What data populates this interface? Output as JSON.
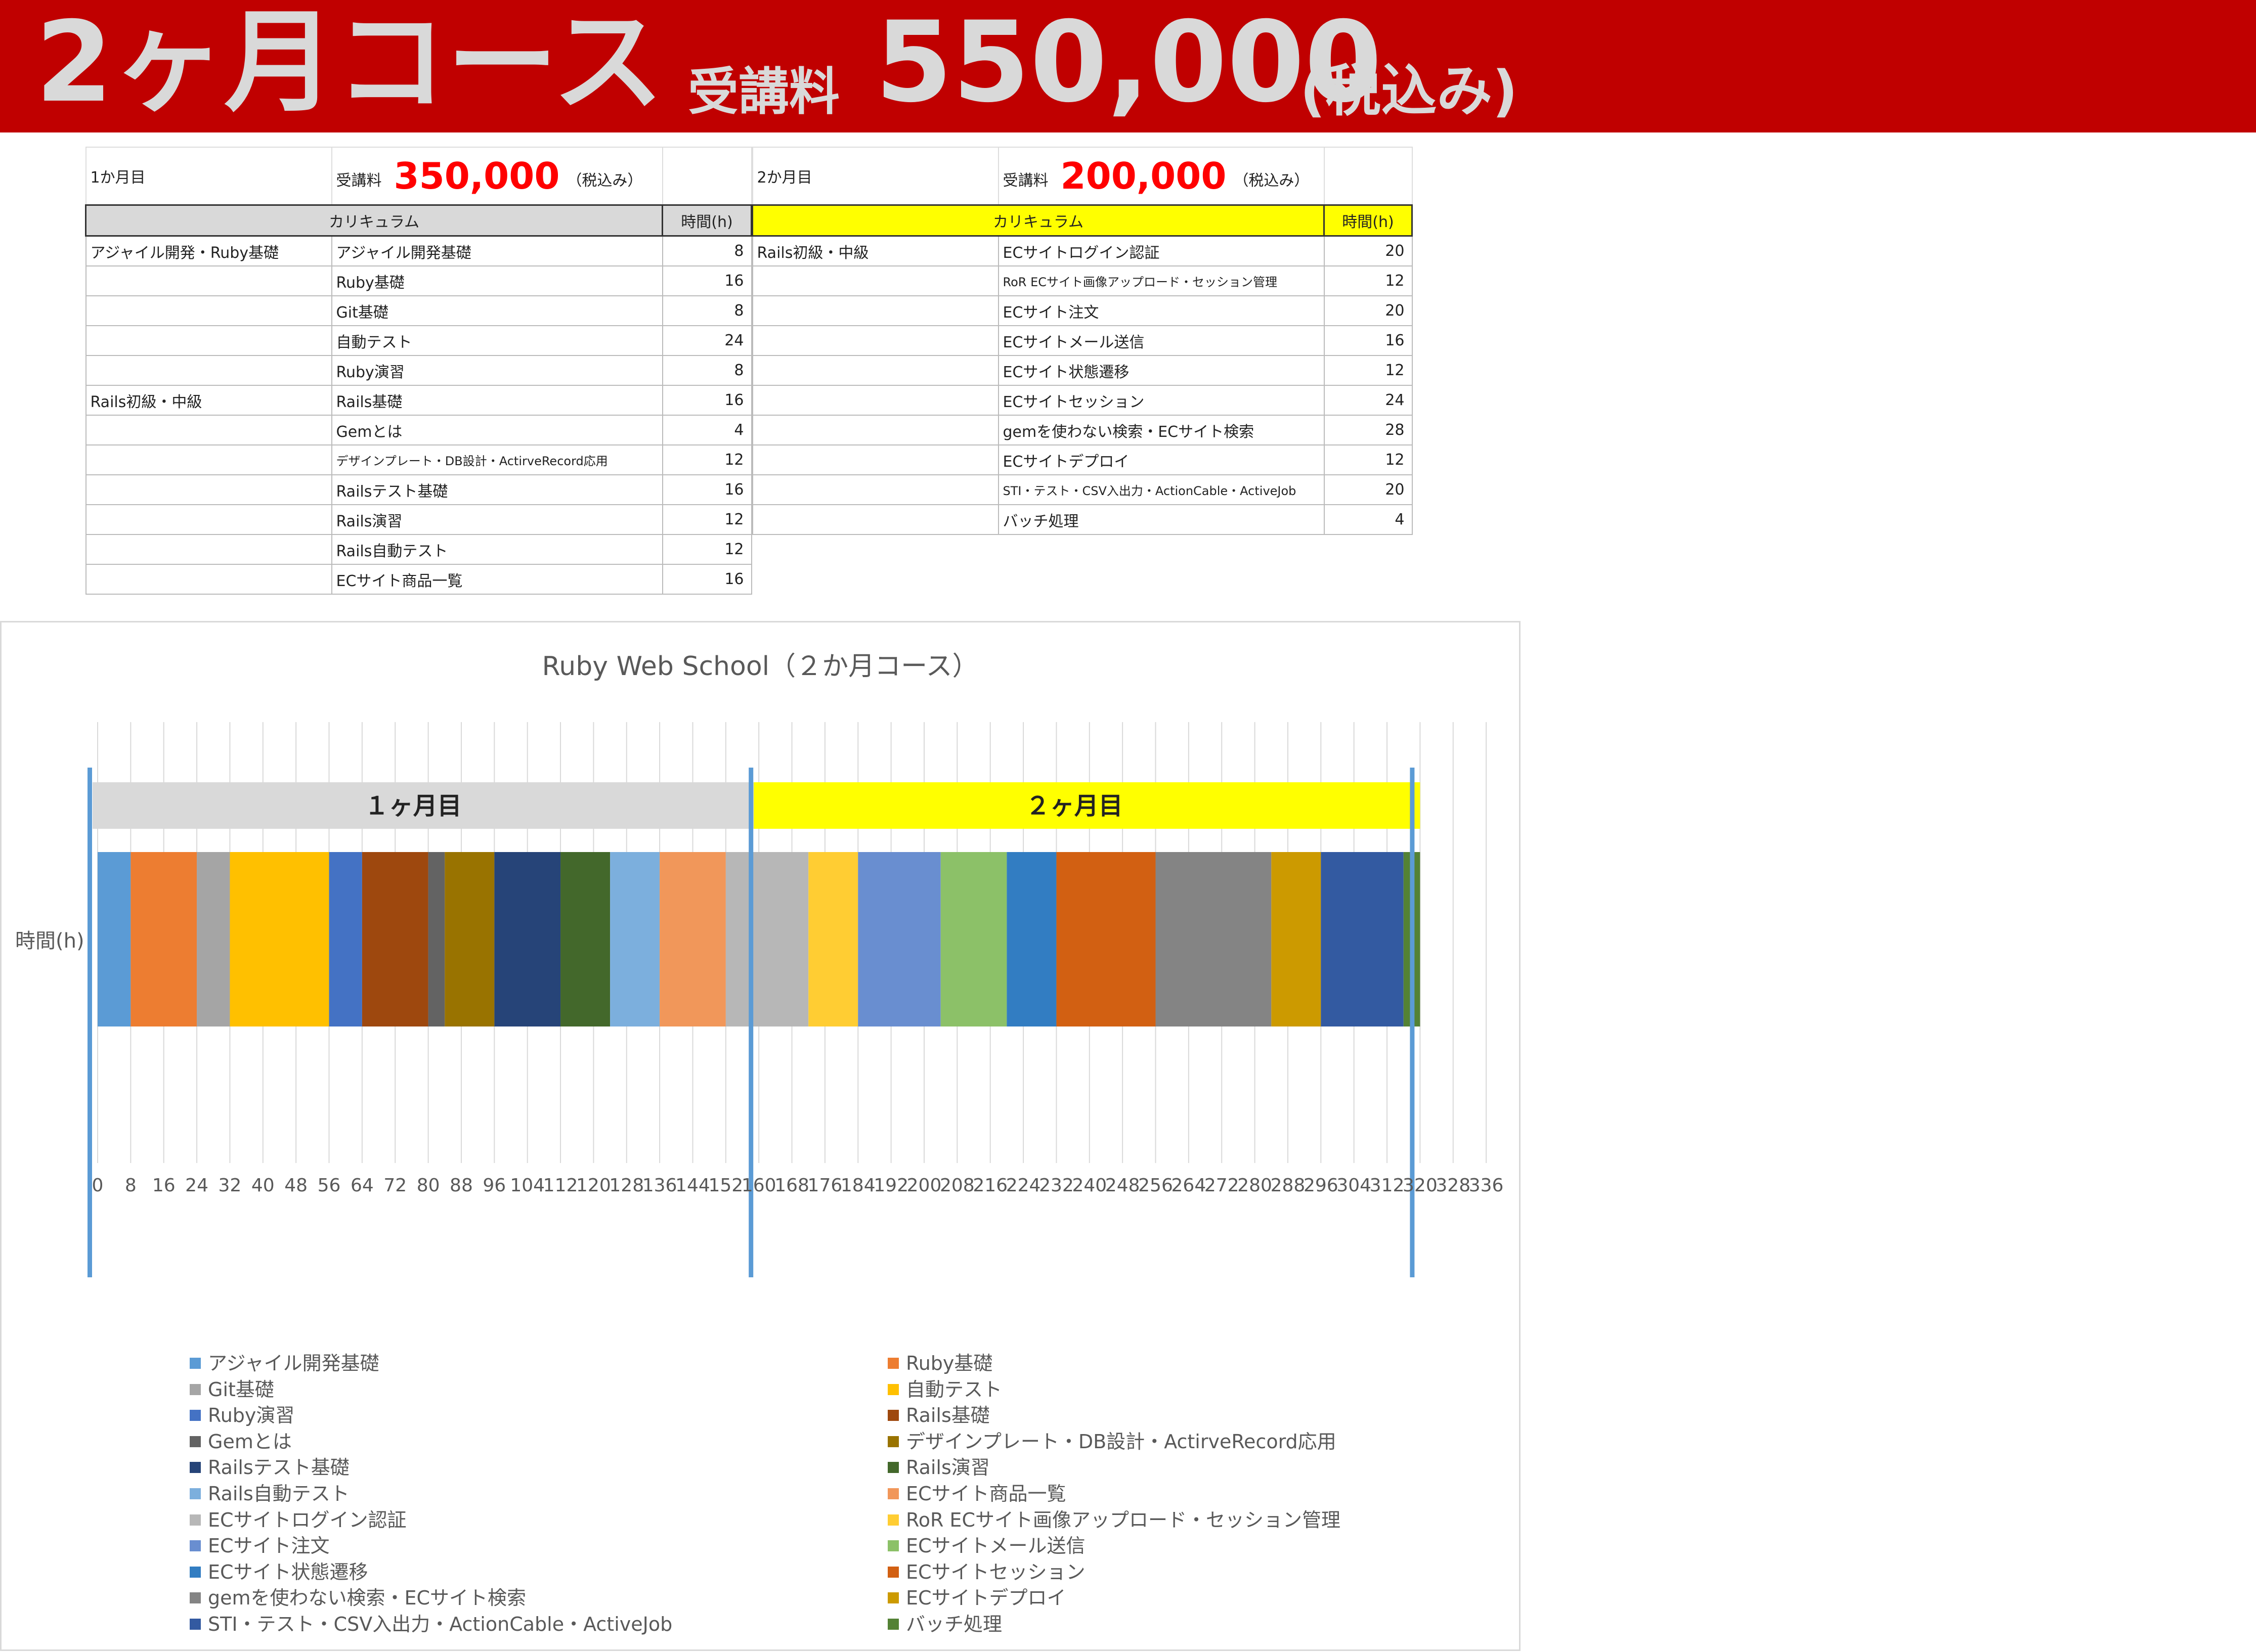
{
  "banner": {
    "course": "2ヶ月コース",
    "fee_label": "受講料",
    "price": "550,000",
    "tax": "(税込み)"
  },
  "month1": {
    "label": "1か月目",
    "fee_label": "受講料",
    "fee": "350,000",
    "tax": "（税込み）",
    "col_curriculum": "カリキュラム",
    "col_hours": "時間(h)",
    "rows": [
      {
        "cat": "アジャイル開発・Ruby基礎",
        "topic": "アジャイル開発基礎",
        "hours": "8"
      },
      {
        "cat": "",
        "topic": "Ruby基礎",
        "hours": "16"
      },
      {
        "cat": "",
        "topic": "Git基礎",
        "hours": "8"
      },
      {
        "cat": "",
        "topic": "自動テスト",
        "hours": "24"
      },
      {
        "cat": "",
        "topic": "Ruby演習",
        "hours": "8"
      },
      {
        "cat": "Rails初級・中級",
        "topic": "Rails基礎",
        "hours": "16"
      },
      {
        "cat": "",
        "topic": "Gemとは",
        "hours": "4"
      },
      {
        "cat": "",
        "topic": "デザインプレート・DB設計・ActirveRecord応用",
        "hours": "12"
      },
      {
        "cat": "",
        "topic": "Railsテスト基礎",
        "hours": "16"
      },
      {
        "cat": "",
        "topic": "Rails演習",
        "hours": "12"
      },
      {
        "cat": "",
        "topic": "Rails自動テスト",
        "hours": "12"
      },
      {
        "cat": "",
        "topic": "ECサイト商品一覧",
        "hours": "16"
      }
    ]
  },
  "month2": {
    "label": "2か月目",
    "fee_label": "受講料",
    "fee": "200,000",
    "tax": "（税込み）",
    "col_curriculum": "カリキュラム",
    "col_hours": "時間(h)",
    "rows": [
      {
        "cat": "Rails初級・中級",
        "topic": "ECサイトログイン認証",
        "hours": "20"
      },
      {
        "cat": "",
        "topic": "RoR ECサイト画像アップロード・セッション管理",
        "hours": "12"
      },
      {
        "cat": "",
        "topic": "ECサイト注文",
        "hours": "20"
      },
      {
        "cat": "",
        "topic": "ECサイトメール送信",
        "hours": "16"
      },
      {
        "cat": "",
        "topic": "ECサイト状態遷移",
        "hours": "12"
      },
      {
        "cat": "",
        "topic": "ECサイトセッション",
        "hours": "24"
      },
      {
        "cat": "",
        "topic": "gemを使わない検索・ECサイト検索",
        "hours": "28"
      },
      {
        "cat": "",
        "topic": "ECサイトデプロイ",
        "hours": "12"
      },
      {
        "cat": "",
        "topic": "STI・テスト・CSV入出力・ActionCable・ActiveJob",
        "hours": "20"
      },
      {
        "cat": "",
        "topic": "バッチ処理",
        "hours": "4"
      }
    ]
  },
  "chart_data": {
    "type": "bar",
    "orientation": "horizontal-stacked",
    "title": "Ruby Web School（２か月コース）",
    "ylabel": "時間(h)",
    "categories": [
      "時間(h)"
    ],
    "xlim": [
      0,
      336
    ],
    "x_ticks": [
      0,
      8,
      16,
      24,
      32,
      40,
      48,
      56,
      64,
      72,
      80,
      88,
      96,
      104,
      112,
      120,
      128,
      136,
      144,
      152,
      160,
      168,
      176,
      184,
      192,
      200,
      208,
      216,
      224,
      232,
      240,
      248,
      256,
      264,
      272,
      280,
      288,
      296,
      304,
      312,
      320,
      328,
      336
    ],
    "grid": true,
    "legend": "bottom",
    "month_bands": [
      {
        "label": "１ヶ月目",
        "start": 0,
        "end": 160,
        "color": "#d9d9d9"
      },
      {
        "label": "２ヶ月目",
        "start": 160,
        "end": 320,
        "color": "#ffff00"
      }
    ],
    "series": [
      {
        "name": "アジャイル開発基礎",
        "value": 8,
        "color": "#5b9bd5"
      },
      {
        "name": "Ruby基礎",
        "value": 16,
        "color": "#ed7d31"
      },
      {
        "name": "Git基礎",
        "value": 8,
        "color": "#a5a5a5"
      },
      {
        "name": "自動テスト",
        "value": 24,
        "color": "#ffc000"
      },
      {
        "name": "Ruby演習",
        "value": 8,
        "color": "#4472c4"
      },
      {
        "name": "Rails基礎",
        "value": 16,
        "color": "#9e480e"
      },
      {
        "name": "Gemとは",
        "value": 4,
        "color": "#636363"
      },
      {
        "name": "デザインプレート・DB設計・ActirveRecord応用",
        "value": 12,
        "color": "#997300"
      },
      {
        "name": "Railsテスト基礎",
        "value": 16,
        "color": "#264478"
      },
      {
        "name": "Rails演習",
        "value": 12,
        "color": "#43682b"
      },
      {
        "name": "Rails自動テスト",
        "value": 12,
        "color": "#7cafdd"
      },
      {
        "name": "ECサイト商品一覧",
        "value": 16,
        "color": "#f1975a"
      },
      {
        "name": "ECサイトログイン認証",
        "value": 20,
        "color": "#b7b7b7"
      },
      {
        "name": "RoR ECサイト画像アップロード・セッション管理",
        "value": 12,
        "color": "#ffcd33"
      },
      {
        "name": "ECサイト注文",
        "value": 20,
        "color": "#698ed0"
      },
      {
        "name": "ECサイトメール送信",
        "value": 16,
        "color": "#8cc168"
      },
      {
        "name": "ECサイト状態遷移",
        "value": 12,
        "color": "#327dc2"
      },
      {
        "name": "ECサイトセッション",
        "value": 24,
        "color": "#d26012"
      },
      {
        "name": "gemを使わない検索・ECサイト検索",
        "value": 28,
        "color": "#848484"
      },
      {
        "name": "ECサイトデプロイ",
        "value": 12,
        "color": "#cc9a00"
      },
      {
        "name": "STI・テスト・CSV入出力・ActionCable・ActiveJob",
        "value": 20,
        "color": "#335aa1"
      },
      {
        "name": "バッチ処理",
        "value": 4,
        "color": "#548235"
      }
    ]
  }
}
